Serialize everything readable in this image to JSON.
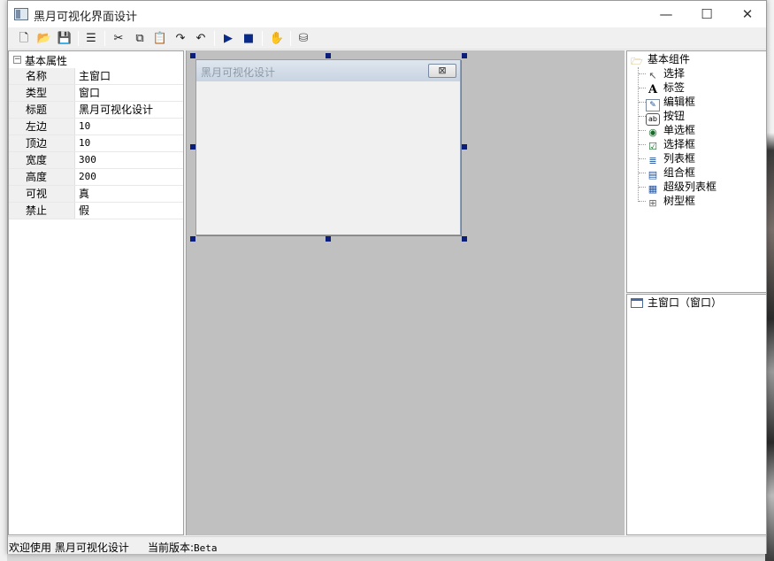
{
  "window": {
    "title": "黑月可视化界面设计",
    "min_glyph": "—",
    "max_glyph": "☐",
    "close_glyph": "✕"
  },
  "toolbar": {
    "buttons": [
      {
        "name": "new-icon",
        "glyph": "🗋"
      },
      {
        "name": "open-icon",
        "glyph": "📂"
      },
      {
        "name": "save-icon",
        "glyph": "💾"
      },
      {
        "name": "list-icon",
        "glyph": "☰"
      },
      {
        "name": "cut-icon",
        "glyph": "✂"
      },
      {
        "name": "copy-icon",
        "glyph": "⧉"
      },
      {
        "name": "paste-icon",
        "glyph": "📋"
      },
      {
        "name": "redo-icon",
        "glyph": "↷"
      },
      {
        "name": "undo-icon",
        "glyph": "↶"
      },
      {
        "name": "run-icon",
        "glyph": "▶"
      },
      {
        "name": "stop-icon",
        "glyph": "■"
      },
      {
        "name": "hand-icon",
        "glyph": "✋"
      },
      {
        "name": "build-icon",
        "glyph": "⛁"
      }
    ]
  },
  "properties": {
    "group_label": "基本属性",
    "expander_glyph": "−",
    "rows": [
      {
        "key": "名称",
        "value": "主窗口"
      },
      {
        "key": "类型",
        "value": "窗口"
      },
      {
        "key": "标题",
        "value": "黑月可视化设计"
      },
      {
        "key": "左边",
        "value": "10"
      },
      {
        "key": "顶边",
        "value": "10"
      },
      {
        "key": "宽度",
        "value": "300"
      },
      {
        "key": "高度",
        "value": "200"
      },
      {
        "key": "可视",
        "value": "真"
      },
      {
        "key": "禁止",
        "value": "假"
      }
    ]
  },
  "design_form": {
    "title": "黑月可视化设计",
    "close_glyph": "⊠"
  },
  "components": {
    "root_label": "基本组件",
    "items": [
      {
        "label": "选择",
        "icon": "pointer-icon",
        "glyph": "↖"
      },
      {
        "label": "标签",
        "icon": "label-icon",
        "glyph": "A"
      },
      {
        "label": "编辑框",
        "icon": "editbox-icon",
        "glyph": "✎"
      },
      {
        "label": "按钮",
        "icon": "button-icon",
        "glyph": "ab"
      },
      {
        "label": "单选框",
        "icon": "radio-icon",
        "glyph": "◉"
      },
      {
        "label": "选择框",
        "icon": "checkbox-icon",
        "glyph": "☑"
      },
      {
        "label": "列表框",
        "icon": "listbox-icon",
        "glyph": "≣"
      },
      {
        "label": "组合框",
        "icon": "combobox-icon",
        "glyph": "▤"
      },
      {
        "label": "超级列表框",
        "icon": "listview-icon",
        "glyph": "▦"
      },
      {
        "label": "树型框",
        "icon": "treeview-icon",
        "glyph": "⊞"
      }
    ]
  },
  "object_tree": {
    "items": [
      {
        "label": "主窗口（窗口）"
      }
    ]
  },
  "status": {
    "welcome": "欢迎使用 黑月可视化设计",
    "version_label": "当前版本:",
    "version_value": "Beta"
  }
}
